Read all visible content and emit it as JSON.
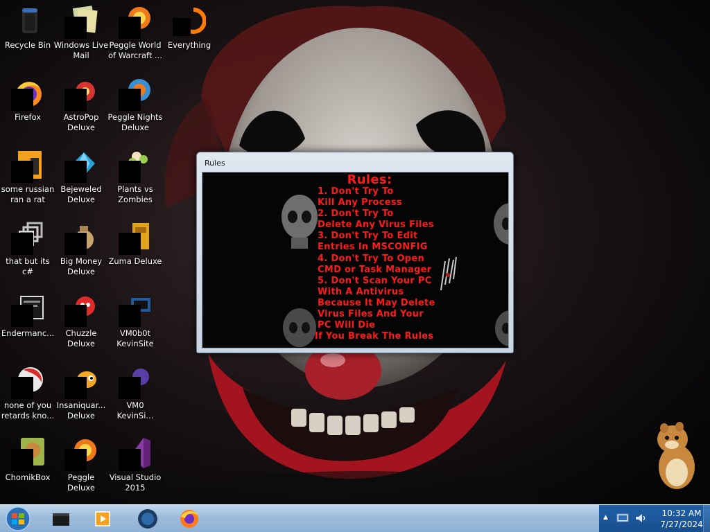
{
  "desktop": {
    "icons": [
      {
        "label": "Recycle Bin",
        "icon": "recycle-bin-icon"
      },
      {
        "label": "Windows Live Mail",
        "icon": "mail-icon"
      },
      {
        "label": "Peggle World of Warcraft ...",
        "icon": "game-icon"
      },
      {
        "label": "Everything",
        "icon": "search-icon"
      },
      {
        "label": "Firefox",
        "icon": "firefox-icon"
      },
      {
        "label": "AstroPop Deluxe",
        "icon": "game-icon"
      },
      {
        "label": "Peggle Nights Deluxe",
        "icon": "game-icon"
      },
      {
        "label": "some russian ran a rat",
        "icon": "file-icon"
      },
      {
        "label": "Bejeweled Deluxe",
        "icon": "gem-icon"
      },
      {
        "label": "Plants vs Zombies",
        "icon": "plant-icon"
      },
      {
        "label": "that but its c#",
        "icon": "document-stack-icon"
      },
      {
        "label": "Big Money Deluxe",
        "icon": "money-bag-icon"
      },
      {
        "label": "Zuma Deluxe",
        "icon": "game-icon"
      },
      {
        "label": "Endermanc...",
        "icon": "terminal-icon"
      },
      {
        "label": "Chuzzle Deluxe",
        "icon": "game-icon"
      },
      {
        "label": "VM0b0t KevinSite",
        "icon": "app-icon"
      },
      {
        "label": "none of you retards kno...",
        "icon": "app-icon"
      },
      {
        "label": "Insaniquar... Deluxe",
        "icon": "fish-icon"
      },
      {
        "label": "VM0 KevinSi...",
        "icon": "app-icon"
      },
      {
        "label": "ChomikBox",
        "icon": "hamster-icon"
      },
      {
        "label": "Peggle Deluxe",
        "icon": "game-icon"
      },
      {
        "label": "Visual Studio 2015",
        "icon": "visual-studio-icon"
      }
    ]
  },
  "window": {
    "title": "Rules",
    "heading": "Rules:",
    "lines": [
      "1. Don't Try To",
      "Kill Any Process",
      "2. Don't Try To",
      "Delete Any Virus Files",
      "3. Don't Try To Edit",
      "Entries In MSCONFIG",
      "4. Don't Try To Open",
      "CMD or Task Manager",
      "5. Don't Scan Your PC",
      "With A Antivirus",
      "Because It May Delete",
      "Virus Files And Your",
      "PC Will Die",
      "If You Break The Rules"
    ],
    "text_color": "#ff1a1a"
  },
  "taskbar": {
    "buttons": [
      "app-icon",
      "media-player-icon",
      "globe-icon",
      "firefox-icon"
    ]
  },
  "clock": {
    "time": "10:32 AM",
    "date": "7/27/2024"
  }
}
